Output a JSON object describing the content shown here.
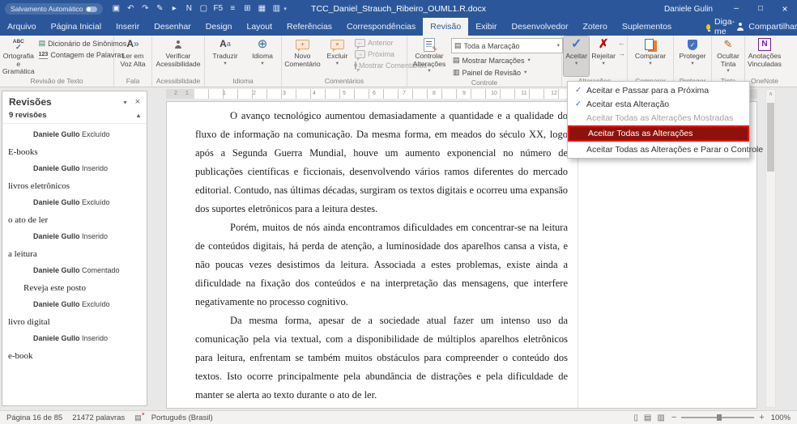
{
  "colors": {
    "accent": "#2b579a",
    "annotation_border": "#ef1010",
    "annotation_fill": "#8b130c"
  },
  "icons": {
    "dropdown_arrow": "▾",
    "close": "×",
    "collapse_chevron": "▴",
    "check": "✓",
    "cross": "✗",
    "book": "▤",
    "globe": "⊕",
    "pen": "✎",
    "letterA": "A",
    "letter_a": "a",
    "speaker": "»",
    "abc": "ABC",
    "numbers123": "123",
    "arrow_left": "←",
    "arrow_right": "→",
    "lines": "≡",
    "markup_lines": "▤",
    "pane_lines": "▥",
    "minimize": "–",
    "maximize": "□",
    "win_close": "×",
    "scroll_up": "∧",
    "minus": "−",
    "plus": "+",
    "read_mode": "▯",
    "print_layout": "▤",
    "web_layout": "▥",
    "qat_more": "▾",
    "bubble_plus": "+",
    "bubble_x": "×",
    "proof_book": "▤",
    "proof_x": "×"
  },
  "titlebar": {
    "autosave": "Salvamento Automático",
    "title": "TCC_Daniel_Strauch_Ribeiro_OUML1.R.docx",
    "user": "Daniele Gulin",
    "qat": [
      {
        "name": "save-icon",
        "glyph": "▣"
      },
      {
        "name": "undo-icon",
        "glyph": "↶"
      },
      {
        "name": "redo-icon",
        "glyph": "↷"
      },
      {
        "name": "draw-icon",
        "glyph": "✎"
      },
      {
        "name": "pointer-icon",
        "glyph": "▸"
      },
      {
        "name": "onenote-icon",
        "glyph": "N"
      },
      {
        "name": "touch-icon",
        "glyph": "▢"
      },
      {
        "name": "f5-icon",
        "glyph": "F5"
      },
      {
        "name": "list-icon",
        "glyph": "≡"
      },
      {
        "name": "table-icon",
        "glyph": "⊞"
      },
      {
        "name": "grid-icon",
        "glyph": "▦"
      },
      {
        "name": "columns-icon",
        "glyph": "▥"
      }
    ]
  },
  "tabs": [
    {
      "label": "Arquivo"
    },
    {
      "label": "Página Inicial"
    },
    {
      "label": "Inserir"
    },
    {
      "label": "Desenhar"
    },
    {
      "label": "Design"
    },
    {
      "label": "Layout"
    },
    {
      "label": "Referências"
    },
    {
      "label": "Correspondências"
    },
    {
      "label": "Revisão",
      "active": true
    },
    {
      "label": "Exibir"
    },
    {
      "label": "Desenvolvedor"
    },
    {
      "label": "Zotero"
    },
    {
      "label": "Suplementos"
    }
  ],
  "tellme": {
    "label": "Diga-me"
  },
  "share": {
    "label": "Compartilhar"
  },
  "ribbon": {
    "group_labels": [
      "Revisão de Texto",
      "Fala",
      "Acessibilidade",
      "Idioma",
      "Comentários",
      "Controle",
      "Alterações",
      "Comparar",
      "Proteger",
      "Tinta",
      "OneNote"
    ],
    "buttons": {
      "spelling": "Ortografia e Gramática",
      "thesaurus": "Dicionário de Sinônimos",
      "word_count": "Contagem de Palavras",
      "read_aloud": "Ler em Voz Alta",
      "accessibility": "Verificar Acessibilidade",
      "translate": "Traduzir",
      "language": "Idioma",
      "new_comment": "Novo Comentário",
      "delete_comment": "Excluir",
      "prev_comment": "Anterior",
      "next_comment": "Próxima",
      "show_comments": "Mostrar Comentários",
      "track_changes": "Controlar Alterações",
      "markup_select": "Toda a Marcação",
      "show_markup": "Mostrar Marcações",
      "review_pane": "Painel de Revisão",
      "accept": "Aceitar",
      "reject": "Rejeitar",
      "compare": "Comparar",
      "protect": "Proteger",
      "hide_ink": "Ocultar Tinta",
      "linked_notes": "Anotações Vinculadas"
    }
  },
  "accept_menu": {
    "items": [
      {
        "label": "Aceitar e Passar para a Próxima",
        "state": "",
        "icon": "accept-next-icon",
        "icon_glyph": "✓"
      },
      {
        "label": "Aceitar esta Alteração",
        "state": "",
        "icon": "accept-change-icon",
        "icon_glyph": "✓"
      },
      {
        "label": "Aceitar Todas as Alterações Mostradas",
        "state": "disabled",
        "icon": "",
        "icon_glyph": ""
      },
      {
        "label": "Aceitar Todas as Alterações",
        "state": "highlight",
        "icon": "",
        "icon_glyph": ""
      },
      {
        "label": "Aceitar Todas as Alterações e Parar o Controle",
        "state": "",
        "icon": "",
        "icon_glyph": ""
      }
    ]
  },
  "revisions_panel": {
    "title": "Revisões",
    "count_label": "9 revisões",
    "entries": [
      {
        "author": "Daniele Gullo",
        "action": "Excluído",
        "content": "E-books"
      },
      {
        "author": "Daniele Gullo",
        "action": "Inserido",
        "content": "livros eletrônicos"
      },
      {
        "author": "Daniele Gullo",
        "action": "Excluído",
        "content": "o ato de ler"
      },
      {
        "author": "Daniele Gullo",
        "action": "Inserido",
        "content": "a leitura"
      },
      {
        "author": "Daniele Gullo",
        "action": "Comentado",
        "content": "Reveja este posto"
      },
      {
        "author": "Daniele Gullo",
        "action": "Excluído",
        "content": "livro digital"
      },
      {
        "author": "Daniele Gullo",
        "action": "Inserido",
        "content": "e-book"
      }
    ]
  },
  "ruler": {
    "numbers": [
      "2",
      "1",
      "1",
      "2",
      "3",
      "4",
      "5",
      "6",
      "7",
      "8",
      "9",
      "10",
      "11",
      "12"
    ]
  },
  "document": {
    "paragraphs": [
      "O avanço tecnológico aumentou demasiadamente a quantidade e a qualidade do fluxo de informação na comunicação. Da mesma forma, em meados do século XX, logo após a Segunda Guerra Mundial, houve um aumento exponencial no número de publicações científicas e ficcionais, desenvolvendo vários ramos diferentes do mercado editorial. Contudo, nas últimas décadas, surgiram os textos digitais e ocorreu uma expansão dos suportes eletrônicos para a leitura destes.",
      "Porém, muitos de nós ainda encontramos dificuldades em concentrar-se na leitura de conteúdos digitais, há perda de atenção, a luminosidade dos aparelhos cansa a vista, e não poucas vezes desistimos da leitura. Associada a estes problemas, existe ainda a dificuldade na fixação dos conteúdos e na interpretação das mensagens, que interfere negativamente no processo cognitivo.",
      "Da mesma forma, apesar de a sociedade atual fazer um intenso uso da comunicação pela via textual, com a disponibilidade de múltiplos aparelhos eletrônicos para leitura, enfrentam se também muitos obstáculos para compreender o conteúdo dos textos. Isto ocorre principalmente pela abundância de distrações e pela dificuldade de manter se alerta ao texto durante o ato de ler."
    ]
  },
  "statusbar": {
    "page": "Página 16 de 85",
    "words": "21472 palavras",
    "language": "Português (Brasil)",
    "zoom": "100%"
  }
}
